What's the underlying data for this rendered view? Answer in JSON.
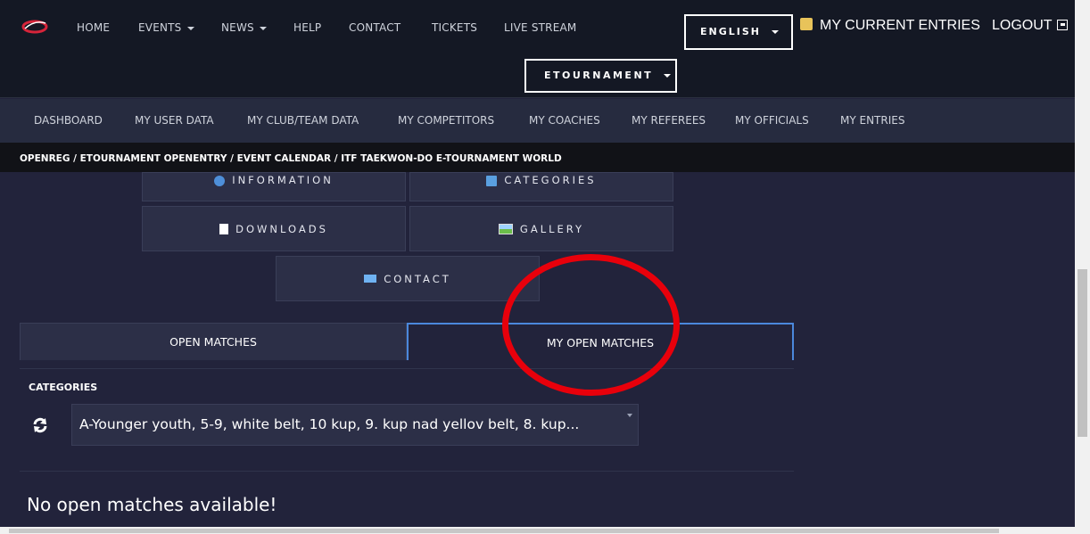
{
  "topnav": {
    "items": [
      {
        "label": "HOME",
        "dropdown": false
      },
      {
        "label": "EVENTS",
        "dropdown": true
      },
      {
        "label": "NEWS",
        "dropdown": true
      },
      {
        "label": "HELP",
        "dropdown": false
      },
      {
        "label": "CONTACT",
        "dropdown": false
      },
      {
        "label": "TICKETS",
        "dropdown": false
      },
      {
        "label": "LIVE STREAM",
        "dropdown": false
      }
    ],
    "language": "ENGLISH",
    "my_entries": "MY CURRENT ENTRIES",
    "logout": "LOGOUT",
    "tournament_select": "ETOURNAMENT"
  },
  "subnav": {
    "items": [
      "DASHBOARD",
      "MY USER DATA",
      "MY CLUB/TEAM DATA",
      "MY COMPETITORS",
      "MY COACHES",
      "MY REFEREES",
      "MY OFFICIALS",
      "MY ENTRIES"
    ]
  },
  "breadcrumb": "OPENREG / ETOURNAMENT OPENENTRY / EVENT CALENDAR / ITF TAEKWON-DO E-TOURNAMENT WORLD",
  "tiles": {
    "information": "INFORMATION",
    "categories": "CATEGORIES",
    "downloads": "DOWNLOADS",
    "gallery": "GALLERY",
    "contact": "CONTACT"
  },
  "tabs": {
    "open_matches": "OPEN MATCHES",
    "my_open_matches": "MY OPEN MATCHES"
  },
  "categories": {
    "title": "CATEGORIES",
    "selected": "A-Younger youth, 5-9, white belt, 10 kup, 9. kup nad yellov belt, 8. kup..."
  },
  "empty_message": "No open matches available!",
  "colors": {
    "background": "#22233b",
    "topbar": "#141824",
    "tile": "#2c2f47",
    "active_tab_border": "#4b88dc",
    "annotation_circle": "#e8000b"
  }
}
